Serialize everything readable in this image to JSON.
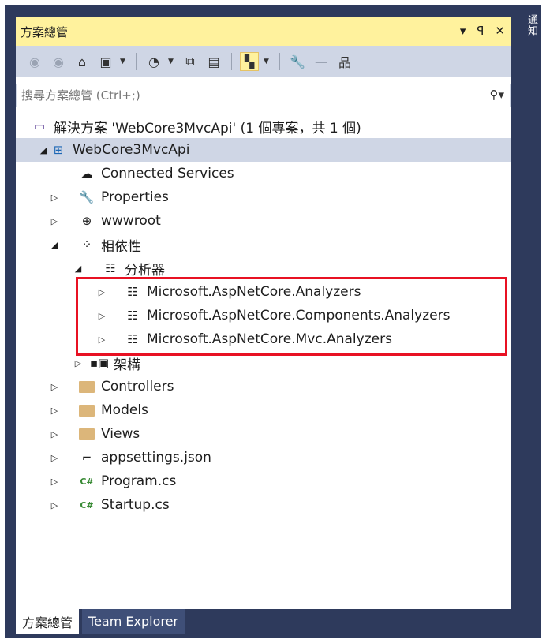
{
  "side_tab_label": "通知",
  "panel_title": "方案總管",
  "title_controls": {
    "dropdown": "▾",
    "pin": "ꟼ",
    "close": "✕"
  },
  "search": {
    "placeholder": "搜尋方案總管 (Ctrl+;)"
  },
  "tree": {
    "solution": "解決方案 'WebCore3MvcApi' (1 個專案，共 1 個)",
    "project": "WebCore3MvcApi",
    "connected_services": "Connected Services",
    "properties": "Properties",
    "wwwroot": "wwwroot",
    "dependencies": "相依性",
    "analyzers": "分析器",
    "analyzer_items": [
      "Microsoft.AspNetCore.Analyzers",
      "Microsoft.AspNetCore.Components.Analyzers",
      "Microsoft.AspNetCore.Mvc.Analyzers"
    ],
    "frameworks": "架構",
    "controllers": "Controllers",
    "models": "Models",
    "views": "Views",
    "appsettings": "appsettings.json",
    "program": "Program.cs",
    "startup": "Startup.cs"
  },
  "bottom_tabs": [
    "方案總管",
    "Team Explorer"
  ],
  "colors": {
    "frame": "#2e3a5c",
    "titlebar": "#fff29d",
    "toolbar": "#cfd6e5",
    "highlight": "#e81123",
    "folder": "#dcb67a",
    "csharp": "#388a34"
  }
}
